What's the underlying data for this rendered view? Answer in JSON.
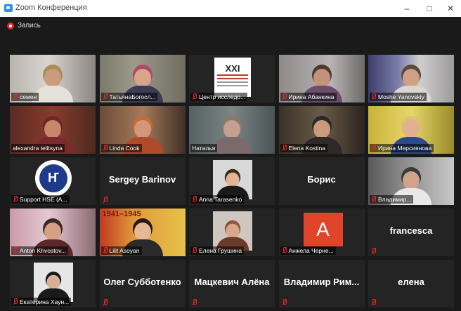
{
  "window": {
    "title": "Zoom Конференция",
    "min_glyph": "–",
    "max_glyph": "□",
    "close_glyph": "✕"
  },
  "recording": {
    "label": "Запись",
    "color": "#e02828"
  },
  "active_speaker_border": "#d6e23a",
  "participants": [
    {
      "name": "семен",
      "muted": true,
      "type": "video"
    },
    {
      "name": "ТатьянаБогосл...",
      "muted": true,
      "type": "video"
    },
    {
      "name": "Центр исследо...",
      "muted": true,
      "type": "logo",
      "logo_text": "XXI"
    },
    {
      "name": "Ирина Абанкина",
      "muted": true,
      "type": "video"
    },
    {
      "name": "Moshe Yanovskiy",
      "muted": true,
      "type": "video"
    },
    {
      "name": "alexandra telitsyna",
      "muted": false,
      "type": "video",
      "active": true
    },
    {
      "name": "Linda Cook",
      "muted": true,
      "type": "video"
    },
    {
      "name": "Наталья",
      "muted": false,
      "type": "video"
    },
    {
      "name": "Elena Kostina",
      "muted": true,
      "type": "video"
    },
    {
      "name": "Ирина Мерсиянова",
      "muted": true,
      "type": "video"
    },
    {
      "name": "Support HSE (A...",
      "muted": true,
      "type": "logo-hse",
      "logo_text": "Ҥ"
    },
    {
      "name": "Sergey Barinov",
      "muted": true,
      "type": "name-only"
    },
    {
      "name": "Anna Tarasenko",
      "muted": true,
      "type": "photo"
    },
    {
      "name": "Борис",
      "muted": false,
      "type": "name-only"
    },
    {
      "name": "Владимир...",
      "muted": true,
      "type": "video"
    },
    {
      "name": "Anton Khvostov...",
      "muted": true,
      "type": "video"
    },
    {
      "name": "Lilit Asoyan",
      "muted": true,
      "type": "video",
      "poster_text": "1941–1945"
    },
    {
      "name": "Елена Грушина",
      "muted": true,
      "type": "photo"
    },
    {
      "name": "Анжела Черне...",
      "muted": true,
      "type": "letter",
      "letter": "A"
    },
    {
      "name": "francesca",
      "muted": true,
      "type": "name-only"
    },
    {
      "name": "Екатерина Хаун...",
      "muted": true,
      "type": "photo"
    },
    {
      "name": "Олег Субботенко",
      "muted": true,
      "type": "name-only"
    },
    {
      "name": "Мацкевич Алёна",
      "muted": true,
      "type": "name-only"
    },
    {
      "name": "Владимир Рим...",
      "muted": true,
      "type": "name-only"
    },
    {
      "name": "елена",
      "muted": true,
      "type": "name-only"
    }
  ]
}
